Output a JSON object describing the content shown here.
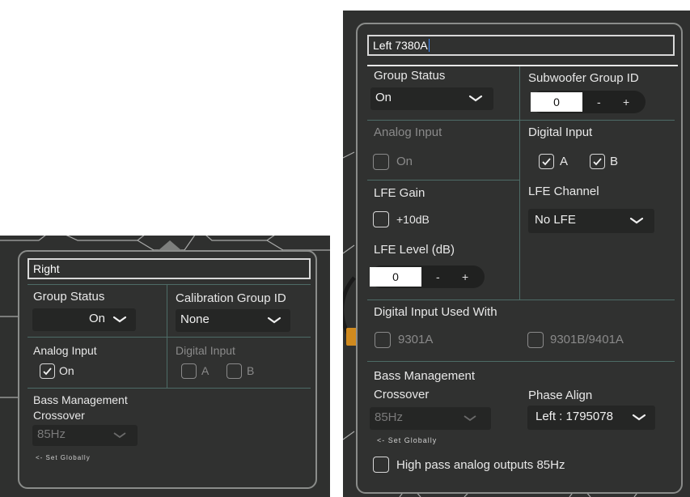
{
  "left_popup": {
    "name_value": "Right",
    "group_status": {
      "label": "Group Status",
      "value": "On"
    },
    "calibration_group": {
      "label": "Calibration Group ID",
      "value": "None"
    },
    "analog_input": {
      "label": "Analog Input",
      "option": "On",
      "checked": true
    },
    "digital_input": {
      "label": "Digital Input",
      "option_a": "A",
      "option_b": "B"
    },
    "bass_management": {
      "label_line1": "Bass Management",
      "label_line2": "Crossover",
      "value": "85Hz",
      "note": "<- Set Globally"
    }
  },
  "right_popup": {
    "name_value": "Left 7380A",
    "group_status": {
      "label": "Group Status",
      "value": "On"
    },
    "subwoofer_group": {
      "label": "Subwoofer Group ID",
      "value": "0",
      "minus": "-",
      "plus": "+"
    },
    "analog_input": {
      "label": "Analog Input",
      "option": "On"
    },
    "digital_input": {
      "label": "Digital Input",
      "option_a": "A",
      "option_b": "B",
      "a_checked": true,
      "b_checked": true
    },
    "lfe_gain": {
      "label": "LFE Gain",
      "option": "+10dB"
    },
    "lfe_channel": {
      "label": "LFE Channel",
      "value": "No LFE"
    },
    "lfe_level": {
      "label": "LFE Level (dB)",
      "value": "0",
      "minus": "-",
      "plus": "+"
    },
    "digital_used_with": {
      "label": "Digital Input Used With",
      "option_1": "9301A",
      "option_2": "9301B/9401A"
    },
    "bass_management": {
      "label_line1": "Bass Management",
      "label_line2": "Crossover",
      "value": "85Hz",
      "note": "<- Set Globally"
    },
    "phase_align": {
      "label": "Phase Align",
      "value": "Left : 1795078"
    },
    "high_pass": {
      "label": "High pass analog outputs 85Hz"
    }
  },
  "colors": {
    "panel": "#303130",
    "divider": "#4d6b66",
    "orange_tab": "#d08a1e",
    "caret": "#3d8bff"
  }
}
